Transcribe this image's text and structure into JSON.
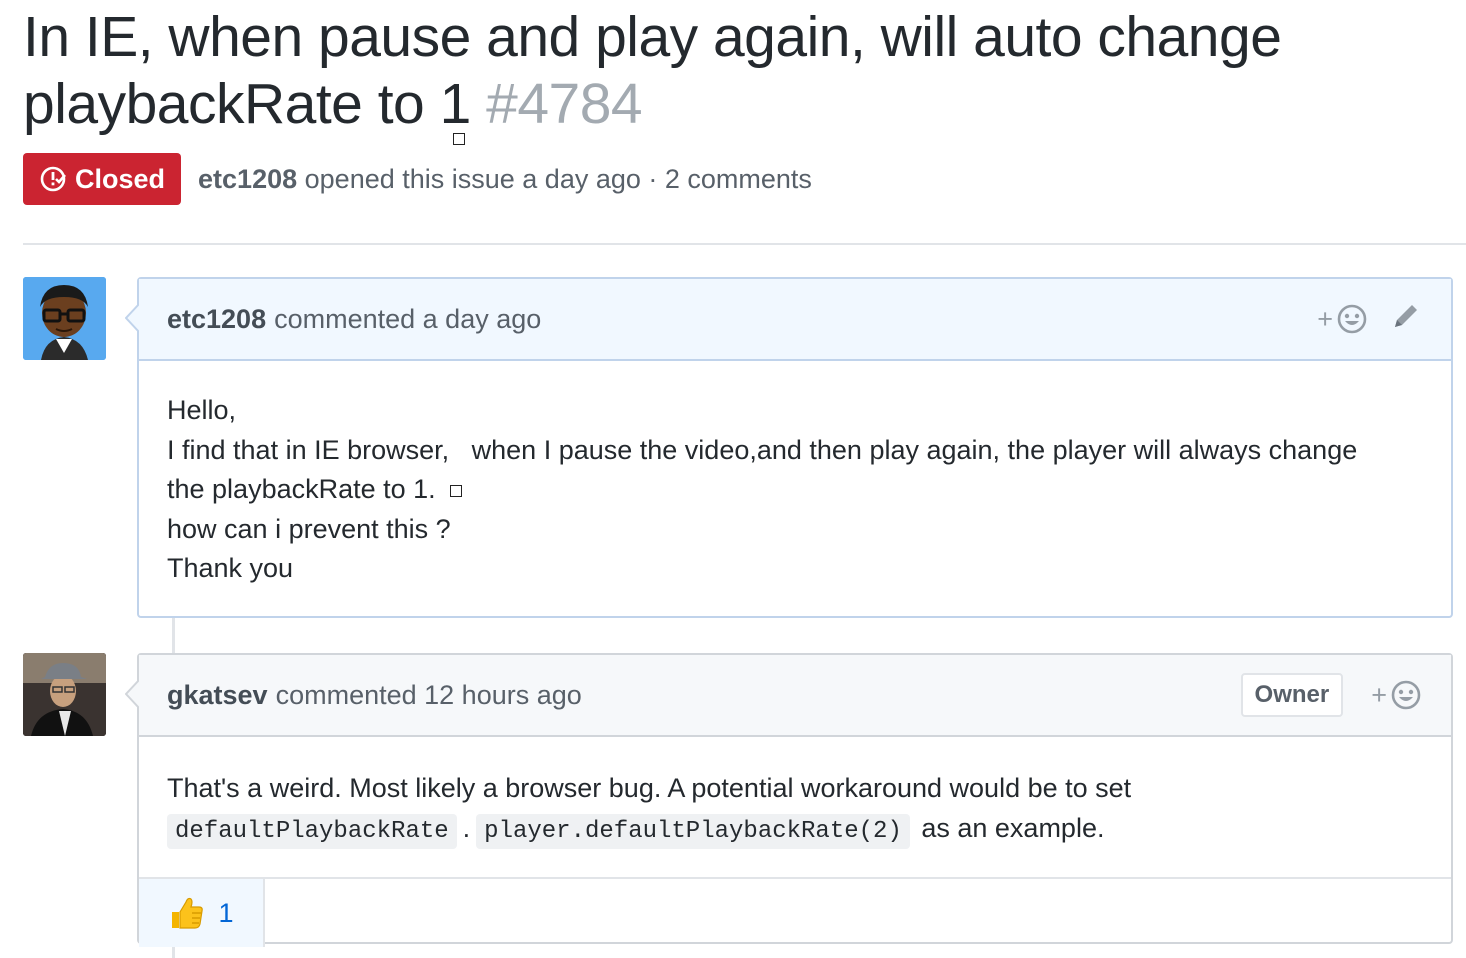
{
  "issue": {
    "title": "In IE, when pause and play again, will auto change playbackRate to 1",
    "number": "#4784",
    "state": "Closed",
    "author": "etc1208",
    "meta": "opened this issue a day ago · 2 comments"
  },
  "colors": {
    "closed_badge": "#cb2431",
    "link_blue": "#0366d6",
    "self_header_bg": "#f1f8ff"
  },
  "comments": [
    {
      "author": "etc1208",
      "meta": "commented a day ago",
      "avatar_icon": "cartoon-avatar",
      "lines": [
        "Hello,",
        "I find that in IE browser,   when I pause the video,and then play again, the player will always change",
        "the playbackRate to 1.",
        "how can i prevent this ?",
        "Thank you"
      ]
    },
    {
      "author": "gkatsev",
      "meta": "commented 12 hours ago",
      "owner_label": "Owner",
      "avatar_icon": "photo-avatar",
      "text_before": "That's a weird. Most likely a browser bug. A potential workaround would be to set",
      "code1": "defaultPlaybackRate",
      "sep": ".",
      "code2": "player.defaultPlaybackRate(2)",
      "text_after": "as an example.",
      "reaction": {
        "icon": "thumbs-up-icon",
        "count": "1"
      }
    }
  ],
  "icons": {
    "add_reaction": "smiley-plus-icon",
    "edit": "pencil-icon",
    "closed_state": "issue-closed-icon"
  },
  "react_plus": "+"
}
